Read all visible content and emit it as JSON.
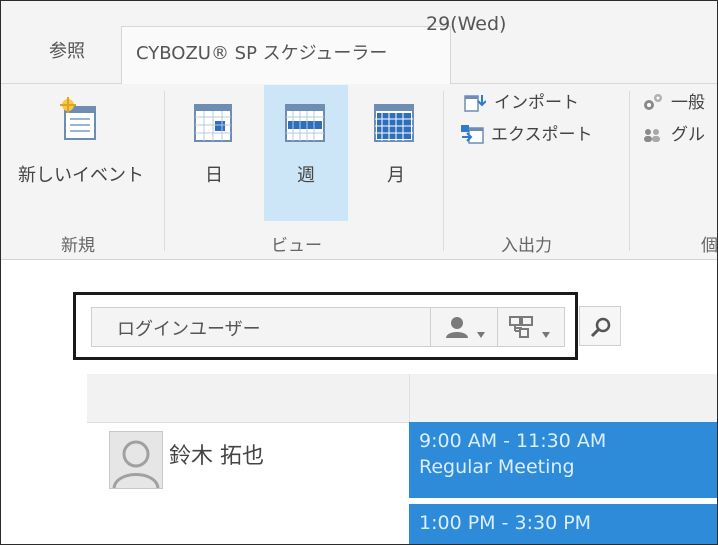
{
  "ribbon": {
    "tabs": [
      {
        "label": "参照",
        "active": false
      },
      {
        "label": "CYBOZU® SP スケジューラー",
        "active": true
      }
    ],
    "groups": {
      "new": {
        "label": "新規",
        "new_event": "新しいイベント"
      },
      "view": {
        "label": "ビュー",
        "day": "日",
        "week": "週",
        "month": "月",
        "selected": "週"
      },
      "io": {
        "label": "入出力",
        "import": "インポート",
        "export": "エクスポート"
      },
      "personal": {
        "label": "個",
        "general": "一般",
        "group": "グル"
      }
    }
  },
  "search": {
    "value": "ログインユーザー"
  },
  "calendar": {
    "date_header": "29(Wed)",
    "user": {
      "name": "鈴木 拓也"
    },
    "events": [
      {
        "time": "9:00 AM - 11:30 AM",
        "title": "Regular Meeting"
      },
      {
        "time": "1:00 PM - 3:30 PM",
        "title": ""
      }
    ]
  },
  "colors": {
    "accent": "#2d8bd9",
    "selected_view": "#cde6f7",
    "ribbon_bg": "#f4f4f4"
  }
}
